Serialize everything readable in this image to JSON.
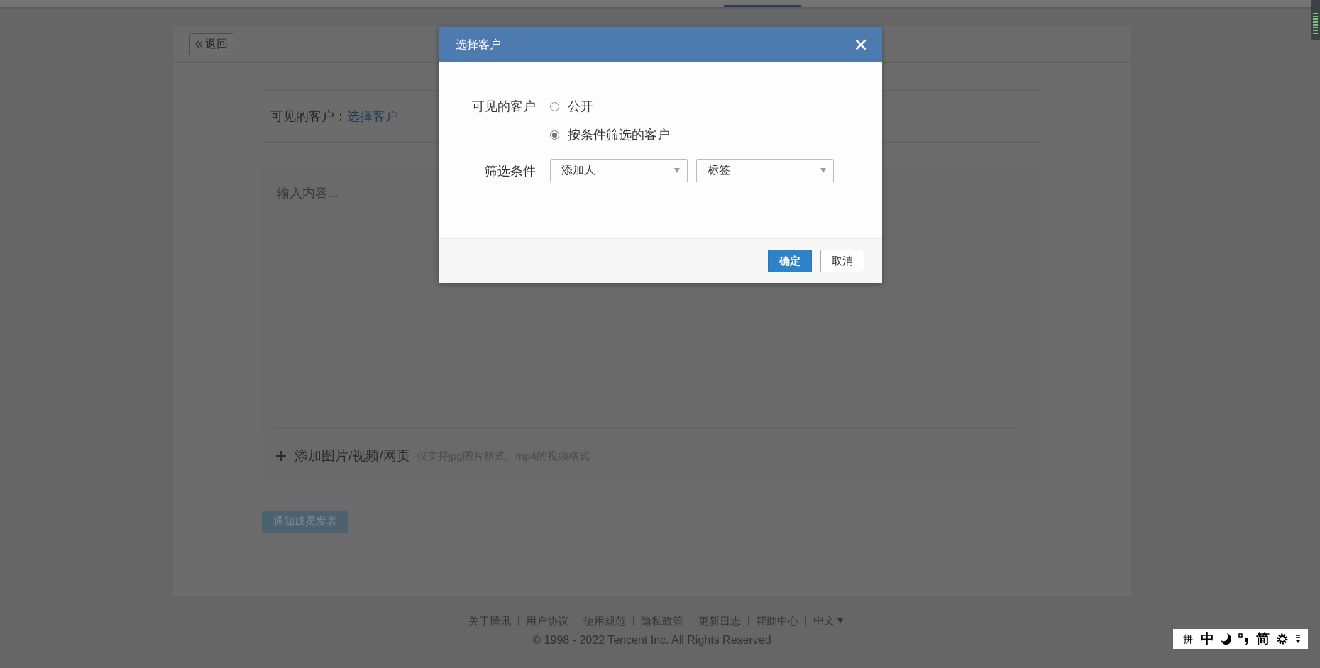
{
  "page": {
    "back_button": "返回",
    "visible_customers": {
      "label": "可见的客户：",
      "link": "选择客户"
    },
    "content_field": {
      "placeholder": "输入内容..."
    },
    "add_media": {
      "label": "添加图片/视频/网页",
      "hint": "仅支持jpg图片格式、mp4的视频格式"
    },
    "submit_button": {
      "label": "通知成员发表",
      "disabled": true
    }
  },
  "dialog": {
    "title": "选择客户",
    "visibility": {
      "label": "可见的客户",
      "options": [
        {
          "label": "公开",
          "selected": false
        },
        {
          "label": "按条件筛选的客户",
          "selected": true
        }
      ]
    },
    "filter": {
      "label": "筛选条件",
      "selects": [
        {
          "value": "添加人"
        },
        {
          "value": "标签"
        }
      ]
    },
    "buttons": [
      {
        "label": "确定",
        "kind": "primary"
      },
      {
        "label": "取消",
        "kind": "default"
      }
    ]
  },
  "footer": {
    "links": [
      "关于腾讯",
      "用户协议",
      "使用规范",
      "隐私政策",
      "更新日志",
      "帮助中心"
    ],
    "language": "中文",
    "copyright": "© 1998 - 2022 Tencent Inc. All Rights Reserved"
  },
  "ime_toolbar": {
    "items": [
      {
        "kind": "boxed",
        "text": "拼"
      },
      {
        "kind": "char",
        "text": "中"
      },
      {
        "kind": "moon"
      },
      {
        "kind": "punct"
      },
      {
        "kind": "char",
        "text": "简"
      },
      {
        "kind": "gear"
      },
      {
        "kind": "more"
      }
    ]
  }
}
